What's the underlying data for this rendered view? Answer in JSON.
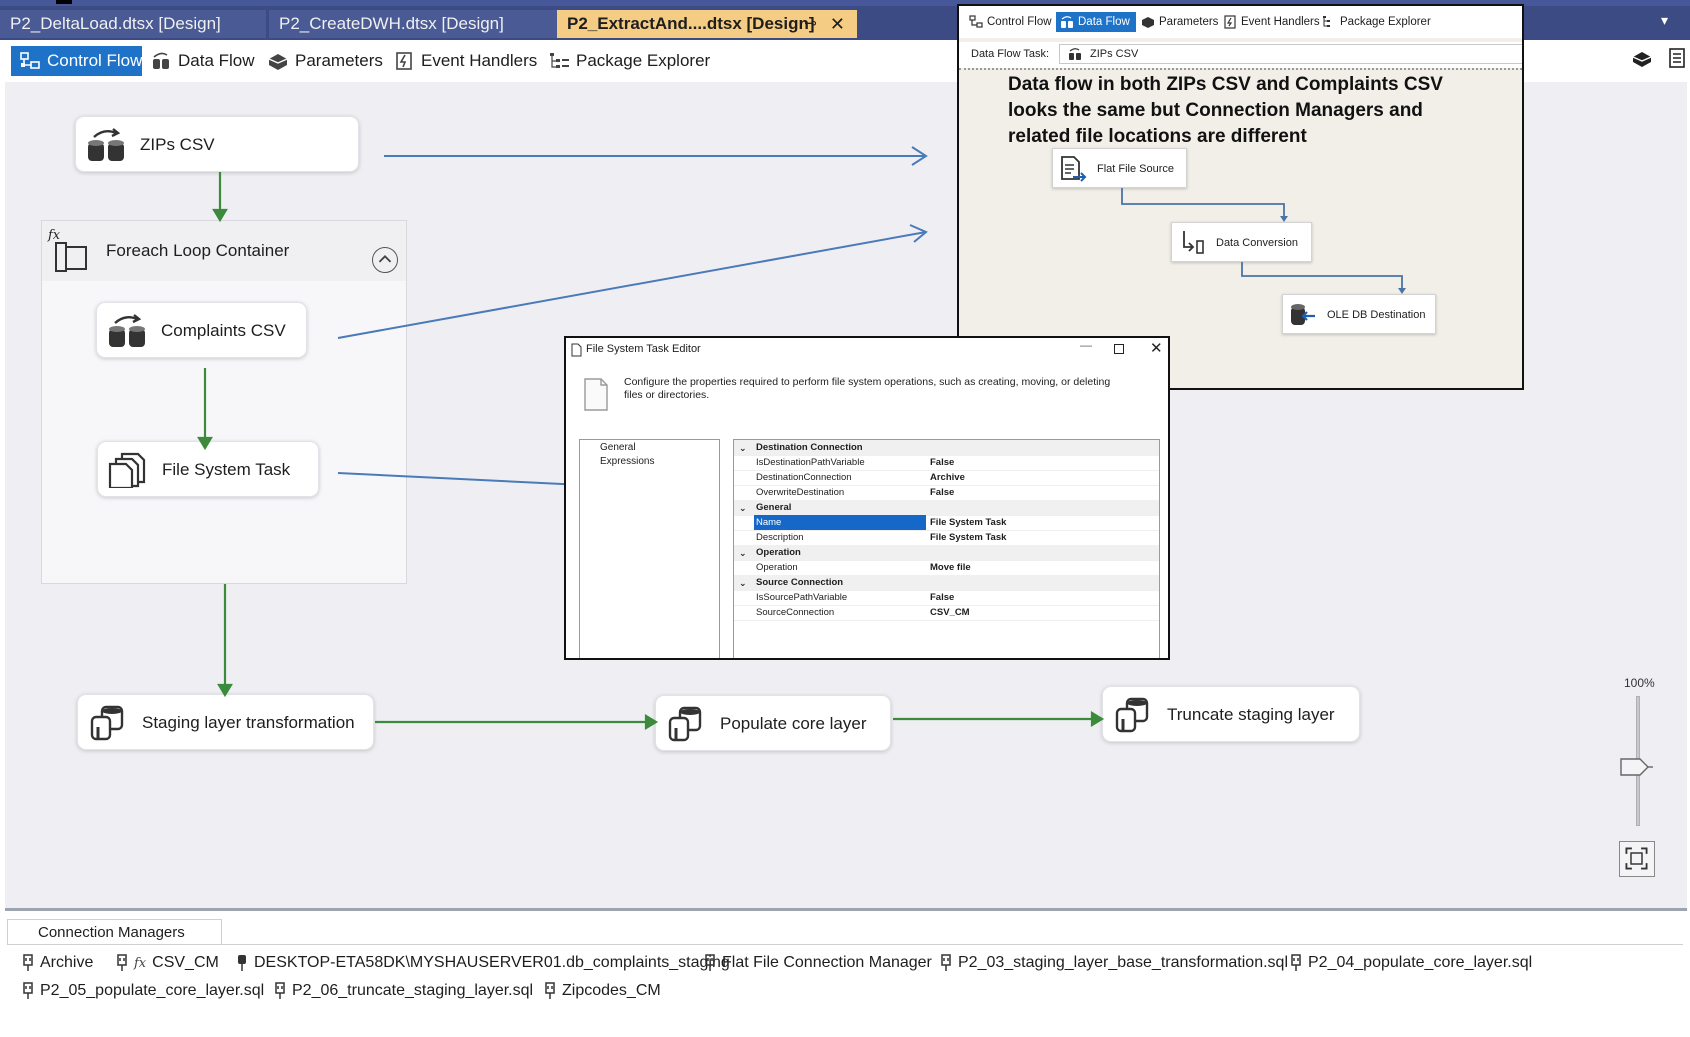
{
  "tabs": [
    {
      "label": "P2_DeltaLoad.dtsx [Design]",
      "active": false
    },
    {
      "label": "P2_CreateDWH.dtsx [Design]",
      "active": false
    },
    {
      "label": "P2_ExtractAnd....dtsx [Design]",
      "active": true
    }
  ],
  "tab_pin": "⊸",
  "tab_close": "✕",
  "tab_menu": "▾",
  "toolbar": {
    "control_flow": "Control Flow",
    "data_flow": "Data Flow",
    "parameters": "Parameters",
    "event_handlers": "Event Handlers",
    "package_explorer": "Package Explorer"
  },
  "canvas": {
    "zips_task": "ZIPs CSV",
    "foreach": "Foreach Loop Container",
    "complaints_task": "Complaints CSV",
    "file_system_task": "File System Task",
    "staging_task": "Staging layer transformation",
    "populate_task": "Populate core layer",
    "truncate_task": "Truncate staging layer"
  },
  "zoom": {
    "label": "100%",
    "level_percent": 100
  },
  "connection_managers": {
    "tab": "Connection Managers",
    "items": [
      "Archive",
      "CSV_CM",
      "DESKTOP-ETA58DK\\MYSHAUSERVER01.db_complaints_staging",
      "Flat File Connection Manager",
      "P2_03_staging_layer_base_transformation.sql",
      "P2_04_populate_core_layer.sql",
      "P2_05_populate_core_layer.sql",
      "P2_06_truncate_staging_layer.sql",
      "Zipcodes_CM"
    ],
    "fx_symbol": "fx"
  },
  "dataflow_popup": {
    "toolbar": {
      "control_flow": "Control Flow",
      "data_flow": "Data Flow",
      "parameters": "Parameters",
      "event_handlers": "Event Handlers",
      "package_explorer": "Package Explorer"
    },
    "task_label": "Data Flow Task:",
    "task_value": "ZIPs CSV",
    "note": "Data flow in both ZIPs CSV and Complaints CSV looks the same but Connection Managers and related file locations are different",
    "components": {
      "source": "Flat File Source",
      "conversion": "Data Conversion",
      "destination": "OLE DB Destination"
    }
  },
  "fs_editor": {
    "title": "File System Task Editor",
    "minimize": "—",
    "close": "✕",
    "description": "Configure the properties required to perform file system operations, such as creating, moving, or deleting files or directories.",
    "nav": [
      "General",
      "Expressions"
    ],
    "chevron": "⌄",
    "groups": {
      "destination": {
        "label": "Destination Connection",
        "rows": [
          {
            "name": "IsDestinationPathVariable",
            "value": "False"
          },
          {
            "name": "DestinationConnection",
            "value": "Archive"
          },
          {
            "name": "OverwriteDestination",
            "value": "False"
          }
        ]
      },
      "general": {
        "label": "General",
        "rows": [
          {
            "name": "Name",
            "value": "File System Task"
          },
          {
            "name": "Description",
            "value": "File System Task"
          }
        ]
      },
      "operation": {
        "label": "Operation",
        "rows": [
          {
            "name": "Operation",
            "value": "Move file"
          }
        ]
      },
      "source": {
        "label": "Source Connection",
        "rows": [
          {
            "name": "IsSourcePathVariable",
            "value": "False"
          },
          {
            "name": "SourceConnection",
            "value": "CSV_CM"
          }
        ]
      }
    }
  },
  "colors": {
    "tab_bar": "#3c4b83",
    "active_tab": "#f5cc84",
    "selected_blue": "#1e73c8",
    "precedence_green": "#3c8a3c",
    "callout_arrow": "#4a7ab8"
  }
}
